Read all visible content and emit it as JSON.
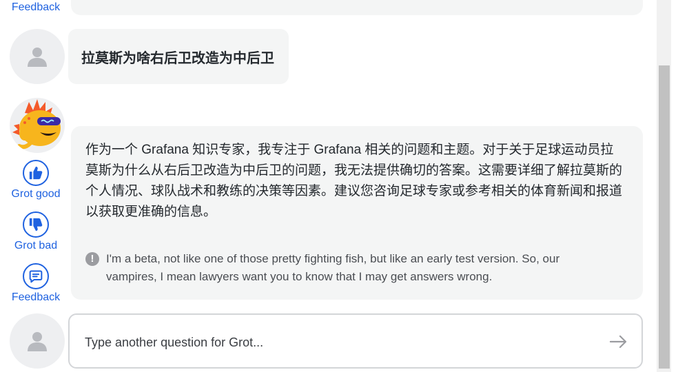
{
  "actions": {
    "top_feedback_label": "Feedback",
    "grot_good_label": "Grot good",
    "grot_bad_label": "Grot bad",
    "feedback_label": "Feedback"
  },
  "user_message": {
    "text": "拉莫斯为啥右后卫改造为中后卫"
  },
  "grot_answer": {
    "text": "作为一个 Grafana 知识专家，我专注于 Grafana 相关的问题和主题。对于关于足球运动员拉莫斯为什么从右后卫改造为中后卫的问题，我无法提供确切的答案。这需要详细了解拉莫斯的个人情况、球队战术和教练的决策等因素。建议您咨询足球专家或参考相关的体育新闻和报道以获取更准确的信息。",
    "disclaimer_icon": "!",
    "disclaimer": "I'm a beta, not like one of those pretty fighting fish, but like an early test version. So, our vampires, I mean lawyers want you to know that I may get answers wrong."
  },
  "input": {
    "placeholder": "Type another question for Grot...",
    "value": ""
  },
  "icons": {
    "thumbs_up": "thumbs-up-icon",
    "thumbs_down": "thumbs-down-icon",
    "feedback": "message-icon",
    "user": "user-icon",
    "send": "arrow-right-icon"
  },
  "colors": {
    "accent": "#1f62e0",
    "bubble_bg": "#f4f5f5",
    "avatar_bg": "#eeeff1"
  }
}
